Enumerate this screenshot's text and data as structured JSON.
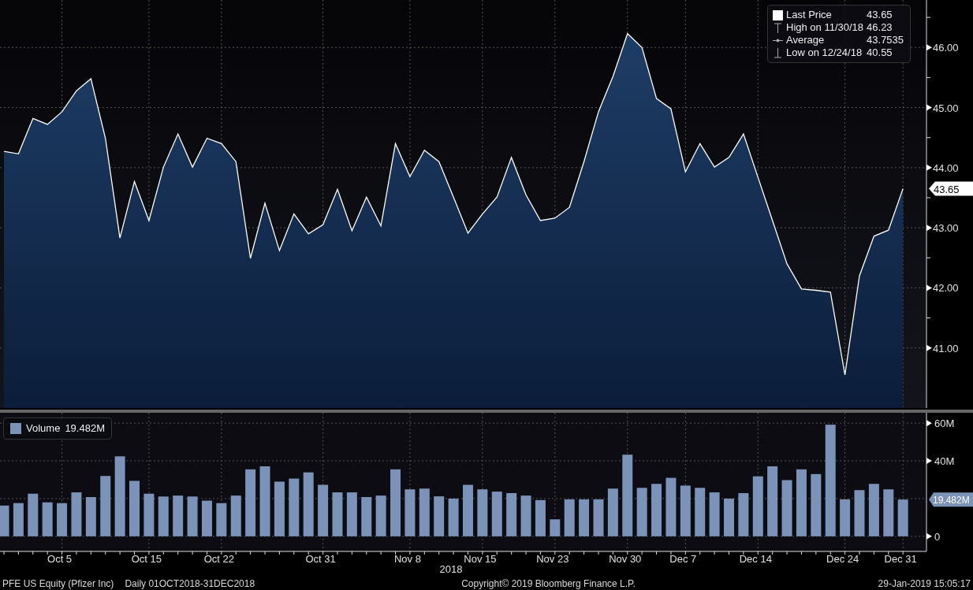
{
  "price_chart": {
    "legend": [
      {
        "kind": "last",
        "value": "43.65"
      },
      {
        "kind": "high",
        "label": "High on 11/30/18",
        "value": "46.23"
      },
      {
        "kind": "average",
        "label": "Average",
        "value": "43.7535"
      },
      {
        "kind": "low",
        "label": "Low on 12/24/18",
        "value": "40.55"
      }
    ],
    "last_marker": "43.65",
    "chart_data": {
      "type": "area",
      "grid": true,
      "series": [
        {
          "name": "Last Price",
          "color": "#ffffff",
          "values": [
            44.27,
            44.23,
            44.82,
            44.72,
            44.93,
            45.28,
            45.48,
            44.49,
            42.83,
            43.77,
            43.12,
            44.01,
            44.56,
            44.01,
            44.49,
            44.4,
            44.1,
            42.49,
            43.41,
            42.62,
            43.23,
            42.9,
            43.05,
            43.64,
            42.95,
            43.51,
            43.03,
            44.4,
            43.85,
            44.29,
            44.1,
            43.51,
            42.91,
            43.23,
            43.51,
            44.17,
            43.55,
            43.12,
            43.16,
            43.34,
            44.1,
            44.93,
            45.52,
            46.23,
            46.0,
            45.15,
            44.98,
            43.93,
            44.4,
            44.01,
            44.17,
            44.56,
            43.84,
            43.12,
            42.4,
            41.98,
            41.96,
            41.93,
            40.55,
            42.2,
            42.86,
            42.96,
            43.65
          ]
        }
      ],
      "ylim": [
        40.0,
        46.79
      ],
      "yticks": [
        {
          "value": 41,
          "label": "41.00"
        },
        {
          "value": 42,
          "label": "42.00"
        },
        {
          "value": 43,
          "label": "43.00"
        },
        {
          "value": 44,
          "label": "44.00"
        },
        {
          "value": 45,
          "label": "45.00"
        },
        {
          "value": 46,
          "label": "46.00"
        }
      ]
    }
  },
  "volume_chart": {
    "legend": {
      "value": "19.482M"
    },
    "last_marker": "19.482M",
    "chart_data": {
      "type": "bar",
      "grid": true,
      "series": [
        {
          "name": "Volume",
          "color": "#7b93b8",
          "values": [
            16.3,
            17.6,
            22.6,
            18.0,
            17.6,
            23.3,
            20.8,
            32.0,
            42.4,
            29.4,
            22.6,
            21.1,
            21.6,
            21.1,
            18.9,
            17.6,
            21.6,
            35.5,
            37.1,
            29.0,
            30.6,
            33.9,
            27.3,
            23.3,
            23.3,
            20.8,
            21.6,
            35.5,
            24.9,
            25.3,
            21.2,
            20.0,
            27.3,
            24.9,
            23.7,
            22.9,
            21.6,
            19.2,
            9.0,
            19.6,
            19.6,
            19.6,
            25.3,
            43.3,
            25.7,
            27.8,
            31.0,
            26.9,
            25.7,
            23.3,
            20.0,
            22.9,
            31.8,
            37.1,
            29.8,
            35.5,
            33.0,
            59.2,
            19.6,
            24.5,
            27.8,
            24.9,
            19.5
          ]
        }
      ],
      "ylim": [
        -8,
        65.5
      ],
      "yticks": [
        {
          "value": 0,
          "label": "0"
        },
        {
          "value": 40,
          "label": "40M"
        },
        {
          "value": 60,
          "label": "60M"
        }
      ]
    }
  },
  "date_axis": {
    "ticks": [
      "Oct 5",
      "Oct 15",
      "Oct 22",
      "Oct 31",
      "Nov 8",
      "Nov 15",
      "Nov 23",
      "Nov 30",
      "Dec 7",
      "Dec 14",
      "Dec 24",
      "Dec 31"
    ],
    "year": "2018"
  },
  "footer": {
    "security": "PFE US Equity (Pfizer Inc)",
    "period": "Daily 01OCT2018-31DEC2018",
    "copyright": "Copyright© 2019 Bloomberg Finance L.P.",
    "timestamp": "29-Jan-2019 15:05:17"
  }
}
